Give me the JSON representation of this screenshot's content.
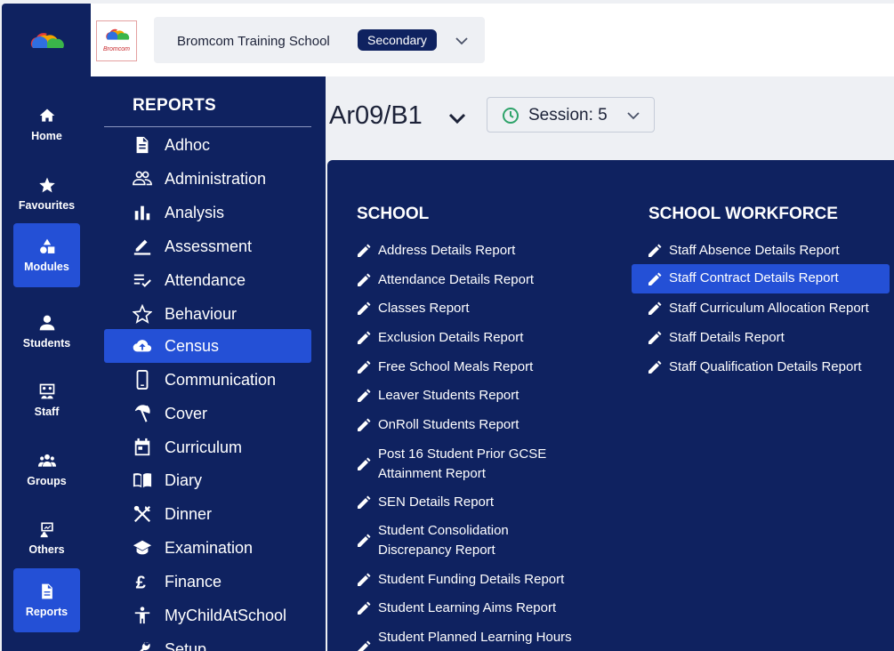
{
  "rail": {
    "items": [
      {
        "label": "Home",
        "icon": "home-icon"
      },
      {
        "label": "Favourites",
        "icon": "star-icon"
      },
      {
        "label": "Modules",
        "icon": "shapes-icon"
      },
      {
        "label": "Students",
        "icon": "person-icon"
      },
      {
        "label": "Staff",
        "icon": "staff-board-icon"
      },
      {
        "label": "Groups",
        "icon": "groups-icon"
      },
      {
        "label": "Others",
        "icon": "others-icon"
      },
      {
        "label": "Reports",
        "icon": "document-icon"
      }
    ],
    "active": "Reports"
  },
  "header": {
    "logo_text": "Bromcom",
    "school_name": "Bromcom Training School",
    "phase": "Secondary"
  },
  "reports_menu": {
    "title": "REPORTS",
    "active": "Census",
    "items": [
      {
        "label": "Adhoc",
        "icon": "document-icon"
      },
      {
        "label": "Administration",
        "icon": "people-icon"
      },
      {
        "label": "Analysis",
        "icon": "bar-chart-icon"
      },
      {
        "label": "Assessment",
        "icon": "edit-line-icon"
      },
      {
        "label": "Attendance",
        "icon": "checklist-icon"
      },
      {
        "label": "Behaviour",
        "icon": "star-outline-icon"
      },
      {
        "label": "Census",
        "icon": "cloud-upload-icon"
      },
      {
        "label": "Communication",
        "icon": "phone-icon"
      },
      {
        "label": "Cover",
        "icon": "umbrella-icon"
      },
      {
        "label": "Curriculum",
        "icon": "calendar-icon"
      },
      {
        "label": "Diary",
        "icon": "book-icon"
      },
      {
        "label": "Dinner",
        "icon": "cutlery-icon"
      },
      {
        "label": "Examination",
        "icon": "graduation-cap-icon"
      },
      {
        "label": "Finance",
        "icon": "pound-icon"
      },
      {
        "label": "MyChildAtSchool",
        "icon": "accessibility-icon"
      },
      {
        "label": "Setup",
        "icon": "wrench-icon"
      }
    ]
  },
  "main": {
    "group_title": "Ar09/B1",
    "session": "Session: 5"
  },
  "panel": {
    "school": {
      "title": "SCHOOL",
      "reports": [
        "Address Details Report",
        "Attendance Details Report",
        "Classes Report",
        "Exclusion Details Report",
        "Free School Meals Report",
        "Leaver Students Report",
        "OnRoll Students Report",
        "Post 16 Student Prior GCSE Attainment Report",
        "SEN Details Report",
        "Student Consolidation Discrepancy Report",
        "Student Funding Details Report",
        "Student Learning Aims Report",
        "Student Planned Learning Hours"
      ]
    },
    "workforce": {
      "title": "SCHOOL WORKFORCE",
      "highlighted": "Staff Contract Details Report",
      "reports": [
        "Staff Absence Details Report",
        "Staff Contract Details Report",
        "Staff Curriculum Allocation Report",
        "Staff Details Report",
        "Staff Qualification Details Report"
      ]
    }
  },
  "colors": {
    "navy": "#0f2260",
    "active_blue": "#2450d6",
    "clock_green": "#2ea36a"
  }
}
